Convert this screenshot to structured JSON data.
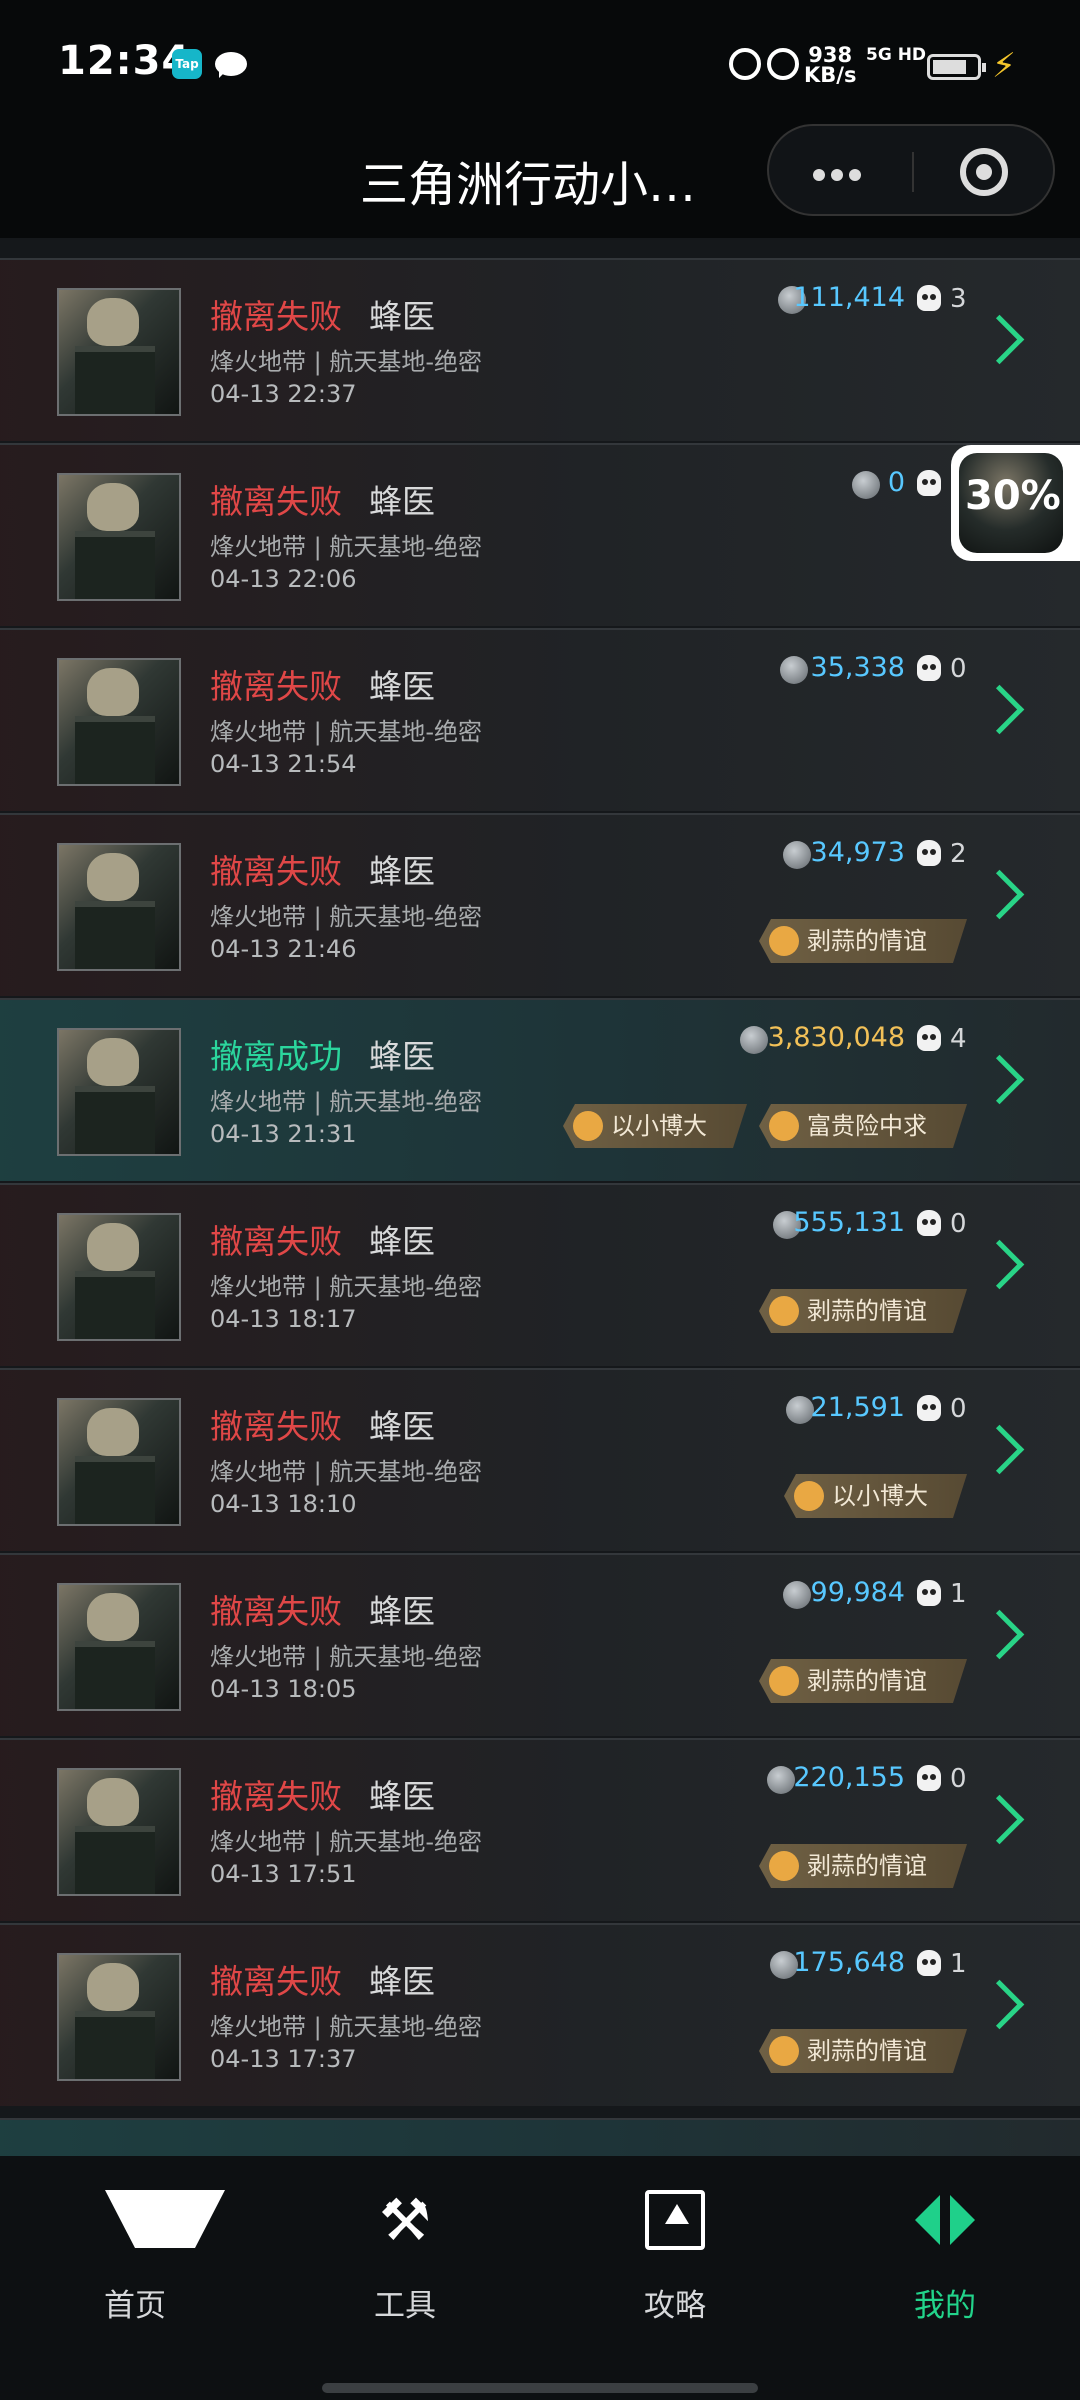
{
  "status_bar": {
    "time": "12:34",
    "app_badge": "Tap",
    "network_speed": "938",
    "network_unit": "KB/s",
    "signal": "5G HD",
    "battery_color": "#dddddd"
  },
  "header": {
    "title": "三角洲行动小…"
  },
  "records": [
    {
      "status": "撤离失败",
      "operator": "蜂医",
      "map": "烽火地带 | 航天基地-绝密",
      "time": "04-13 22:37",
      "value": "111,414",
      "kills": "3",
      "tags": []
    },
    {
      "status": "撤离失败",
      "operator": "蜂医",
      "map": "烽火地带 | 航天基地-绝密",
      "time": "04-13 22:06",
      "value": "0",
      "kills": "",
      "tags": []
    },
    {
      "status": "撤离失败",
      "operator": "蜂医",
      "map": "烽火地带 | 航天基地-绝密",
      "time": "04-13 21:54",
      "value": "35,338",
      "kills": "0",
      "tags": []
    },
    {
      "status": "撤离失败",
      "operator": "蜂医",
      "map": "烽火地带 | 航天基地-绝密",
      "time": "04-13 21:46",
      "value": "34,973",
      "kills": "2",
      "tags": [
        "剥蒜的情谊"
      ]
    },
    {
      "status": "撤离成功",
      "operator": "蜂医",
      "map": "烽火地带 | 航天基地-绝密",
      "time": "04-13 21:31",
      "value": "3,830,048",
      "kills": "4",
      "tags": [
        "以小博大",
        "富贵险中求"
      ]
    },
    {
      "status": "撤离失败",
      "operator": "蜂医",
      "map": "烽火地带 | 航天基地-绝密",
      "time": "04-13 18:17",
      "value": "555,131",
      "kills": "0",
      "tags": [
        "剥蒜的情谊"
      ]
    },
    {
      "status": "撤离失败",
      "operator": "蜂医",
      "map": "烽火地带 | 航天基地-绝密",
      "time": "04-13 18:10",
      "value": "21,591",
      "kills": "0",
      "tags": [
        "以小博大"
      ]
    },
    {
      "status": "撤离失败",
      "operator": "蜂医",
      "map": "烽火地带 | 航天基地-绝密",
      "time": "04-13 18:05",
      "value": "99,984",
      "kills": "1",
      "tags": [
        "剥蒜的情谊"
      ]
    },
    {
      "status": "撤离失败",
      "operator": "蜂医",
      "map": "烽火地带 | 航天基地-绝密",
      "time": "04-13 17:51",
      "value": "220,155",
      "kills": "0",
      "tags": [
        "剥蒜的情谊"
      ]
    },
    {
      "status": "撤离失败",
      "operator": "蜂医",
      "map": "烽火地带 | 航天基地-绝密",
      "time": "04-13 17:37",
      "value": "175,648",
      "kills": "1",
      "tags": [
        "剥蒜的情谊"
      ]
    }
  ],
  "floating_progress": "30%",
  "tabs": [
    {
      "label": "首页",
      "icon": "home-logo-icon",
      "active": false
    },
    {
      "label": "工具",
      "icon": "tools-icon",
      "active": false
    },
    {
      "label": "攻略",
      "icon": "guide-icon",
      "active": false
    },
    {
      "label": "我的",
      "icon": "profile-icon",
      "active": true
    }
  ]
}
